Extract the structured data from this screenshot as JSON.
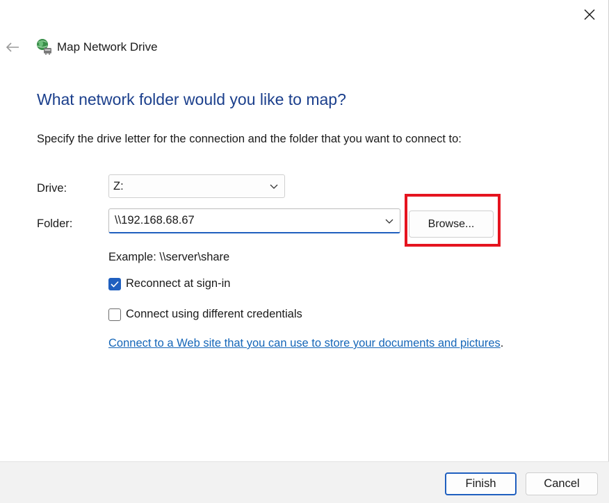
{
  "window": {
    "title": "Map Network Drive"
  },
  "content": {
    "heading": "What network folder would you like to map?",
    "instructions": "Specify the drive letter for the connection and the folder that you want to connect to:",
    "drive_label": "Drive:",
    "drive_value": "Z:",
    "folder_label": "Folder:",
    "folder_value": "\\\\192.168.68.67",
    "browse_label": "Browse...",
    "example": "Example: \\\\server\\share",
    "reconnect_label": "Reconnect at sign-in",
    "reconnect_checked": true,
    "credentials_label": "Connect using different credentials",
    "credentials_checked": false,
    "link_text": "Connect to a Web site that you can use to store your documents and pictures",
    "link_suffix": "."
  },
  "footer": {
    "finish_label": "Finish",
    "cancel_label": "Cancel"
  },
  "icons": {
    "close": "close-icon",
    "back": "back-arrow-icon",
    "app": "network-drive-icon",
    "dropdown": "chevron-down-icon",
    "check": "checkmark-icon"
  },
  "colors": {
    "heading": "#1b3f8c",
    "accent": "#1f5fbf",
    "link": "#1566b8",
    "highlight": "#e5141f"
  }
}
